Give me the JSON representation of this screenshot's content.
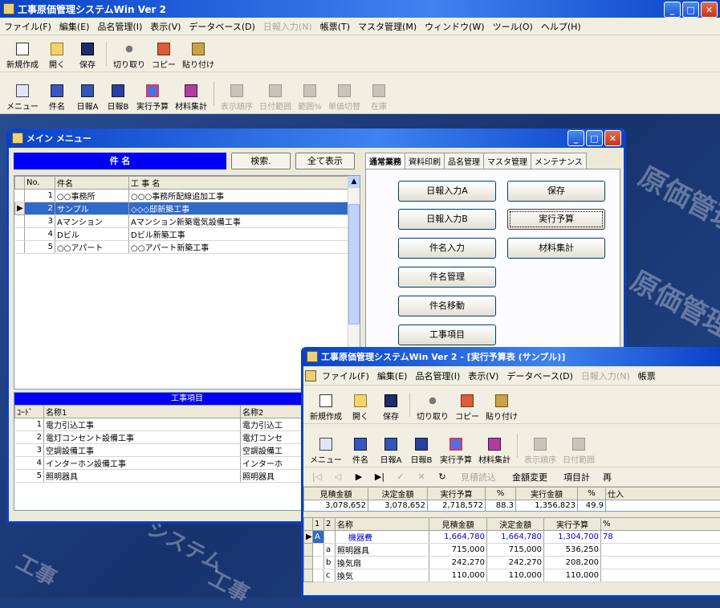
{
  "app": {
    "title": "工事原価管理システムWin Ver 2"
  },
  "menu": [
    "ファイル(F)",
    "編集(E)",
    "品名管理(I)",
    "表示(V)",
    "データベース(D)",
    "日報入力(N)",
    "帳票(T)",
    "マスタ管理(M)",
    "ウィンドウ(W)",
    "ツール(O)",
    "ヘルプ(H)"
  ],
  "menu_disabled_index": 5,
  "toolbar1": [
    {
      "label": "新規作成",
      "icon": "new-doc-icon"
    },
    {
      "label": "開く",
      "icon": "open-folder-icon"
    },
    {
      "label": "保存",
      "icon": "save-disk-icon"
    },
    {
      "label": "切り取り",
      "icon": "scissors-icon"
    },
    {
      "label": "コピー",
      "icon": "copy-icon"
    },
    {
      "label": "貼り付け",
      "icon": "paste-icon"
    }
  ],
  "toolbar2": [
    {
      "label": "メニュー",
      "icon": "menu-icon"
    },
    {
      "label": "件名",
      "icon": "subject-icon"
    },
    {
      "label": "日報A",
      "icon": "daily-report-a-icon"
    },
    {
      "label": "日報B",
      "icon": "daily-report-b-icon"
    },
    {
      "label": "実行予算",
      "icon": "execution-budget-icon"
    },
    {
      "label": "材料集計",
      "icon": "material-summary-icon"
    },
    {
      "label": "表示順序",
      "icon": "display-order-icon",
      "disabled": true
    },
    {
      "label": "日付範囲",
      "icon": "date-range-icon",
      "disabled": true
    },
    {
      "label": "範囲%",
      "icon": "range-percent-icon",
      "disabled": true
    },
    {
      "label": "単価切替",
      "icon": "unit-price-switch-icon",
      "disabled": true
    },
    {
      "label": "在庫",
      "icon": "stock-icon",
      "disabled": true
    }
  ],
  "watermark": [
    "原価管理シ",
    "原価管理シ",
    "システム",
    "工事",
    "工事"
  ],
  "main_menu": {
    "title": "メイン メニュー",
    "subject_header": "件 名",
    "search_button": "検索.",
    "show_all_button": "全て表示",
    "columns": [
      "No.",
      "件名",
      "工 事 名"
    ],
    "rows": [
      [
        "1",
        "○○事務所",
        "○○○事務所配線追加工事"
      ],
      [
        "2",
        "サンプル",
        "◇◇◇邸新築工事"
      ],
      [
        "3",
        "Aマンション",
        "Aマンション新築電気設備工事"
      ],
      [
        "4",
        "Dビル",
        "Dビル新築工事"
      ],
      [
        "5",
        "○○アパート",
        "○○アパート新築工事"
      ]
    ],
    "selected_row": 1,
    "tabs": [
      "通常業務",
      "資料印刷",
      "品名管理",
      "マスタ管理",
      "メンテナンス"
    ],
    "active_tab": 0,
    "buttons_left": [
      "日報入力A",
      "日報入力B",
      "件名入力",
      "件名管理",
      "件名移動",
      "工事項目"
    ],
    "buttons_right": [
      "保存",
      "実行予算",
      "材料集計"
    ],
    "items_header": "工事項目",
    "items_columns": [
      "ｺｰﾄﾞ",
      "名称1",
      "名称2"
    ],
    "items_rows": [
      [
        "1",
        "電力引込工事",
        "電力引込工"
      ],
      [
        "2",
        "電灯コンセント設備工事",
        "電灯コンセ"
      ],
      [
        "3",
        "空調設備工事",
        "空調設備工"
      ],
      [
        "4",
        "インターホン設備工事",
        "インターホ"
      ],
      [
        "5",
        "照明器具",
        "照明器具"
      ]
    ]
  },
  "budget": {
    "title": "工事原価管理システムWin Ver 2 - [実行予算表 (サンプル)]",
    "menu": [
      "ファイル(F)",
      "編集(E)",
      "品名管理(I)",
      "表示(V)",
      "データベース(D)",
      "日報入力(N)",
      "帳票"
    ],
    "menu_disabled_index": 5,
    "nav": [
      "|◁",
      "◁",
      "▶",
      "▶|",
      "✓",
      "✕",
      "↻"
    ],
    "nav_labels": [
      "見積読込",
      "金額変更",
      "項目計",
      "再"
    ],
    "summary_headers": [
      "見積金額",
      "決定金額",
      "実行予算",
      "%",
      "実行金額",
      "%",
      "仕入"
    ],
    "summary_values": [
      "3,078,652",
      "3,078,652",
      "2,718,572",
      "88.3",
      "1,356,823",
      "49.9",
      ""
    ],
    "grid_headers": [
      "1",
      "2",
      "名称",
      "見積金額",
      "決定金額",
      "実行予算",
      "%"
    ],
    "grid_rows": [
      [
        "A",
        "",
        "機器費",
        "1,664,780",
        "1,664,780",
        "1,304,700",
        "78"
      ],
      [
        "",
        "a",
        "照明器具",
        "715,000",
        "715,000",
        "536,250",
        ""
      ],
      [
        "",
        "b",
        "換気扇",
        "242,270",
        "242,270",
        "208,200",
        ""
      ],
      [
        "",
        "c",
        "換気",
        "110,000",
        "110,000",
        "110,000",
        ""
      ]
    ]
  }
}
